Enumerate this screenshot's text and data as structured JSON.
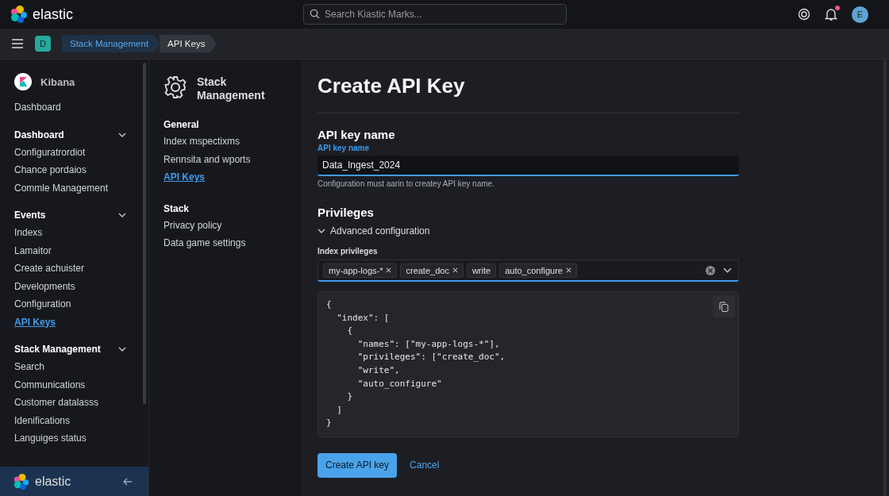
{
  "header": {
    "brand": "elastic",
    "search": {
      "placeholder": "Search Kiastic Marks..."
    },
    "notification_unread": true,
    "avatar": "E"
  },
  "breadcrumbs": {
    "space": "D",
    "items": [
      {
        "label": "Stack Management",
        "selected": false
      },
      {
        "label": "API Keys",
        "selected": true
      }
    ]
  },
  "sidebar": {
    "app": "Kibana",
    "top_item": {
      "label": "Dashboard",
      "selected": false
    },
    "groups": [
      {
        "title": "Dashboard",
        "expanded": true,
        "items": [
          {
            "label": "Configuratrordiot",
            "selected": false
          },
          {
            "label": "Chance pordaios",
            "selected": false
          },
          {
            "label": "Commle Management",
            "selected": false
          }
        ]
      },
      {
        "title": "Events",
        "expanded": true,
        "items": [
          {
            "label": "Indexs",
            "selected": false
          },
          {
            "label": "Lamaitor",
            "selected": false
          },
          {
            "label": "Create achuister",
            "selected": false
          },
          {
            "label": "Developments",
            "selected": false
          },
          {
            "label": "Configuration",
            "selected": false
          },
          {
            "label": "API Keys",
            "selected": true
          }
        ]
      },
      {
        "title": "Stack Management",
        "expanded": true,
        "items": [
          {
            "label": "Search",
            "selected": false
          },
          {
            "label": "Communications",
            "selected": false
          },
          {
            "label": "Customer datalasss",
            "selected": false
          },
          {
            "label": "Idenifications",
            "selected": false
          },
          {
            "label": "Languiges status",
            "selected": false
          }
        ]
      }
    ],
    "footer": "elastic"
  },
  "subnav": {
    "title": "Stack Management",
    "sections": [
      {
        "title": "General",
        "items": [
          {
            "label": "Index mspectixms",
            "selected": false
          },
          {
            "label": "Rennsita and wports",
            "selected": false
          },
          {
            "label": "API Keys",
            "selected": true
          }
        ]
      },
      {
        "title": "Stack",
        "items": [
          {
            "label": "Privacy policy",
            "selected": false
          },
          {
            "label": "Data game settings",
            "selected": false
          }
        ]
      }
    ]
  },
  "main": {
    "title": "Create API Key",
    "name_section": {
      "heading": "API key name",
      "label": "API key name",
      "value": "Data_Ingest_2024",
      "help": "Configuration must aarin to createy API key name."
    },
    "privileges": {
      "heading": "Privileges",
      "toggle": {
        "label": "Advanced configuration",
        "expanded": true
      },
      "label": "Index privileges",
      "chips": [
        {
          "label": "my-app-logs-*",
          "removable": true
        },
        {
          "label": "create_doc",
          "removable": true
        },
        {
          "label": "write",
          "removable": false
        },
        {
          "label": "auto_configure",
          "removable": true
        }
      ],
      "code": [
        "{",
        "  \"index\": [",
        "    {",
        "      \"names\": [\"my-app-logs-*\"],",
        "      \"privileges\": [\"create_doc\",",
        "      \"write\",",
        "      \"auto_configure\"",
        "    }",
        "  ]",
        "}"
      ]
    },
    "buttons": [
      {
        "label": "Create API key",
        "kind": "primary"
      },
      {
        "label": "Cancel",
        "kind": "link"
      }
    ]
  }
}
